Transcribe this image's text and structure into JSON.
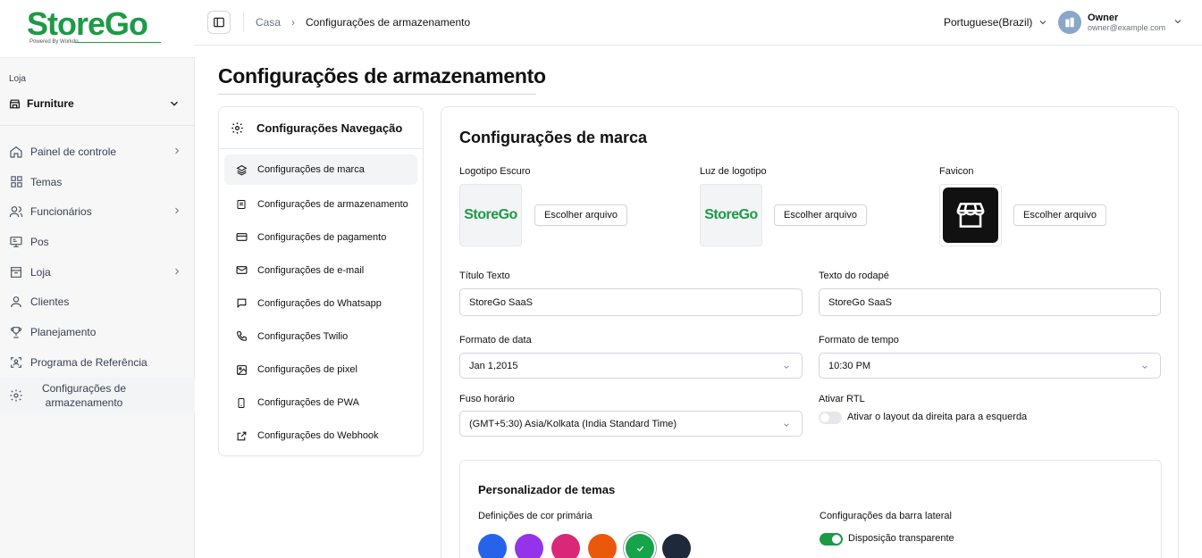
{
  "brand": {
    "name": "StoreGo",
    "tagline": "Powered By Workdo"
  },
  "sidebar": {
    "store_label": "Loja",
    "store_value": "Furniture",
    "items": [
      {
        "label": "Painel de controle",
        "icon": "home-icon",
        "has_arrow": true
      },
      {
        "label": "Temas",
        "icon": "grid-icon",
        "has_arrow": false
      },
      {
        "label": "Funcionários",
        "icon": "users-icon",
        "has_arrow": true
      },
      {
        "label": "Pos",
        "icon": "pos-icon",
        "has_arrow": false
      },
      {
        "label": "Loja",
        "icon": "store-icon",
        "has_arrow": true
      },
      {
        "label": "Clientes",
        "icon": "user-icon",
        "has_arrow": false
      },
      {
        "label": "Planejamento",
        "icon": "trophy-icon",
        "has_arrow": false
      },
      {
        "label": "Programa de Referência",
        "icon": "referral-icon",
        "has_arrow": false
      },
      {
        "label": "Configurações de armazenamento",
        "icon": "gear-icon",
        "has_arrow": false
      }
    ]
  },
  "topbar": {
    "breadcrumb": {
      "home": "Casa",
      "separator": "›",
      "current": "Configurações de armazenamento"
    },
    "language": "Portuguese(Brazil)",
    "user": {
      "name": "Owner",
      "email": "owner@example.com"
    }
  },
  "page": {
    "title": "Configurações de armazenamento"
  },
  "settings_nav": {
    "title": "Configurações Navegação",
    "items": [
      {
        "label": "Configurações de marca",
        "icon": "layers-icon"
      },
      {
        "label": "Configurações de armazenamento",
        "icon": "storage-icon"
      },
      {
        "label": "Configurações de pagamento",
        "icon": "credit-card-icon"
      },
      {
        "label": "Configurações de e-mail",
        "icon": "mail-icon"
      },
      {
        "label": "Configurações do Whatsapp",
        "icon": "chat-icon"
      },
      {
        "label": "Configurações Twilio",
        "icon": "phone-icon"
      },
      {
        "label": "Configurações de pixel",
        "icon": "image-icon"
      },
      {
        "label": "Configurações de PWA",
        "icon": "mobile-icon"
      },
      {
        "label": "Configurações do Webhook",
        "icon": "external-link-icon"
      }
    ]
  },
  "brand_settings": {
    "title": "Configurações de marca",
    "dark_logo_label": "Logotipo Escuro",
    "light_logo_label": "Luz de logotipo",
    "favicon_label": "Favicon",
    "choose_file": "Escolher arquivo",
    "title_text_label": "Título Texto",
    "title_text_value": "StoreGo SaaS",
    "footer_text_label": "Texto do rodapé",
    "footer_text_value": "StoreGo SaaS",
    "date_format_label": "Formato de data",
    "date_format_value": "Jan 1,2015",
    "time_format_label": "Formato de tempo",
    "time_format_value": "10:30 PM",
    "timezone_label": "Fuso horário",
    "timezone_value": "(GMT+5:30) Asia/Kolkata (India Standard Time)",
    "rtl_label": "Ativar RTL",
    "rtl_toggle_label": "Ativar o layout da direita para a esquerda",
    "rtl_enabled": false
  },
  "theme_customizer": {
    "title": "Personalizador de temas",
    "primary_color_label": "Definições de cor primária",
    "colors": [
      "#2563eb",
      "#9333ea",
      "#db2777",
      "#ea580c",
      "#16a34a",
      "#1e293b"
    ],
    "selected_color": "#16a34a",
    "sidebar_label": "Configurações da barra lateral",
    "transparent_label": "Disposição transparente",
    "transparent_enabled": true
  }
}
